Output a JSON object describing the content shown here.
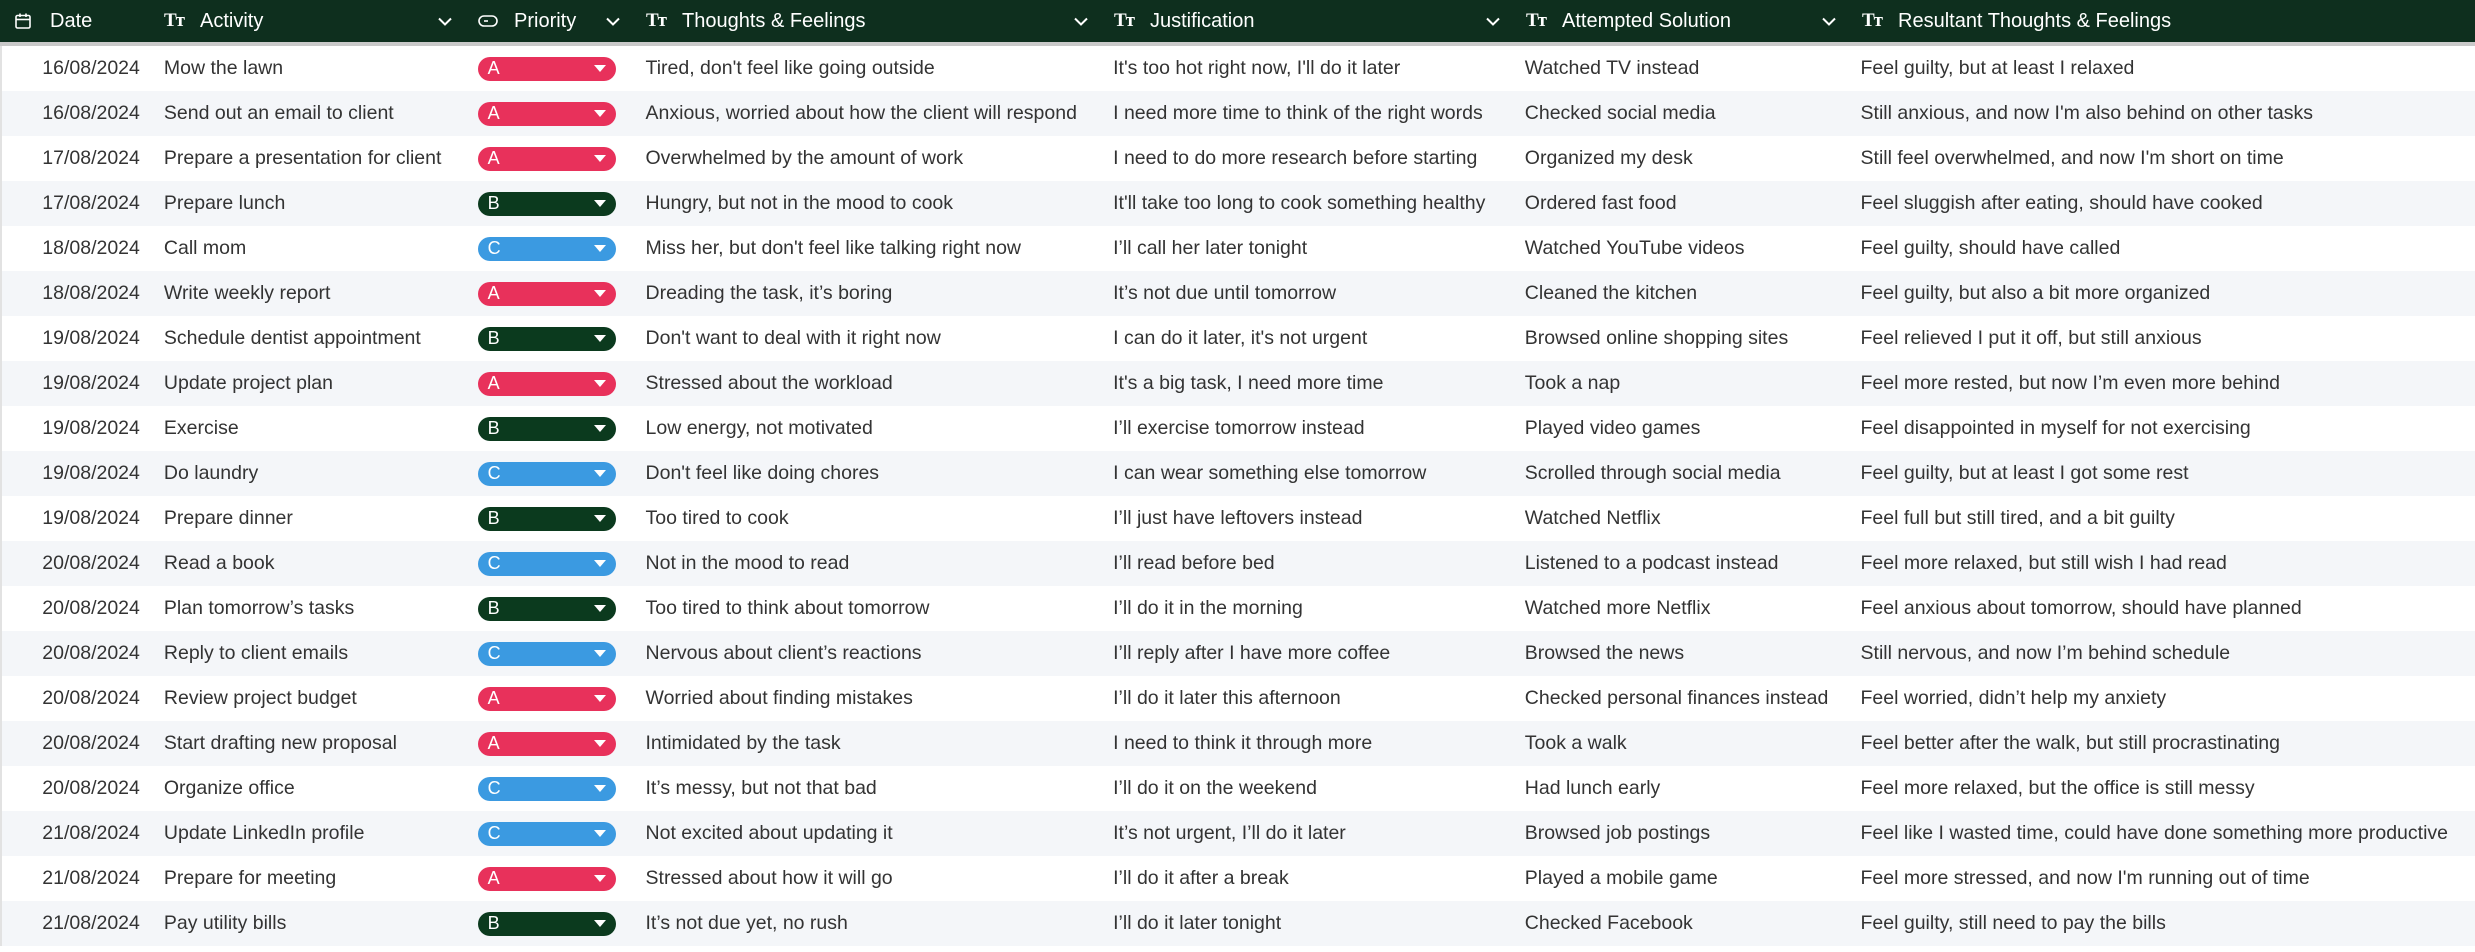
{
  "columns": [
    {
      "key": "date",
      "label": "Date",
      "icon": "calendar-icon"
    },
    {
      "key": "activity",
      "label": "Activity",
      "icon": "text-type-icon"
    },
    {
      "key": "priority",
      "label": "Priority",
      "icon": "select-pill-icon"
    },
    {
      "key": "thoughts",
      "label": "Thoughts & Feelings",
      "icon": "text-type-icon"
    },
    {
      "key": "justification",
      "label": "Justification",
      "icon": "text-type-icon"
    },
    {
      "key": "attempted",
      "label": "Attempted Solution",
      "icon": "text-type-icon"
    },
    {
      "key": "resultant",
      "label": "Resultant Thoughts & Feelings",
      "icon": "text-type-icon"
    }
  ],
  "colors": {
    "header_bg": "#0e2f1e",
    "priority": {
      "A": "#e8315b",
      "B": "#0b3a1e",
      "C": "#3b9ae1"
    }
  },
  "rows": [
    {
      "date": "16/08/2024",
      "activity": "Mow the lawn",
      "priority": "A",
      "thoughts": "Tired, don't feel like going outside",
      "justification": "It's too hot right now, I'll do it later",
      "attempted": "Watched TV instead",
      "resultant": "Feel guilty, but at least I relaxed"
    },
    {
      "date": "16/08/2024",
      "activity": "Send out an email to client",
      "priority": "A",
      "thoughts": "Anxious, worried about how the client will respond",
      "justification": "I need more time to think of the right words",
      "attempted": "Checked social media",
      "resultant": "Still anxious, and now I'm also behind on other tasks"
    },
    {
      "date": "17/08/2024",
      "activity": "Prepare a presentation for client",
      "priority": "A",
      "thoughts": "Overwhelmed by the amount of work",
      "justification": "I need to do more research before starting",
      "attempted": "Organized my desk",
      "resultant": "Still feel overwhelmed, and now I'm short on time"
    },
    {
      "date": "17/08/2024",
      "activity": "Prepare lunch",
      "priority": "B",
      "thoughts": "Hungry, but not in the mood to cook",
      "justification": "It'll take too long to cook something healthy",
      "attempted": "Ordered fast food",
      "resultant": "Feel sluggish after eating, should have cooked"
    },
    {
      "date": "18/08/2024",
      "activity": "Call mom",
      "priority": "C",
      "thoughts": "Miss her, but don't feel like talking right now",
      "justification": "I’ll call her later tonight",
      "attempted": "Watched YouTube videos",
      "resultant": "Feel guilty, should have called"
    },
    {
      "date": "18/08/2024",
      "activity": "Write weekly report",
      "priority": "A",
      "thoughts": "Dreading the task, it’s boring",
      "justification": "It’s not due until tomorrow",
      "attempted": "Cleaned the kitchen",
      "resultant": "Feel guilty, but also a bit more organized"
    },
    {
      "date": "19/08/2024",
      "activity": "Schedule dentist appointment",
      "priority": "B",
      "thoughts": "Don't want to deal with it right now",
      "justification": "I can do it later, it's not urgent",
      "attempted": "Browsed online shopping sites",
      "resultant": "Feel relieved I put it off, but still anxious"
    },
    {
      "date": "19/08/2024",
      "activity": "Update project plan",
      "priority": "A",
      "thoughts": "Stressed about the workload",
      "justification": "It's a big task, I need more time",
      "attempted": "Took a nap",
      "resultant": "Feel more rested, but now I’m even more behind"
    },
    {
      "date": "19/08/2024",
      "activity": "Exercise",
      "priority": "B",
      "thoughts": "Low energy, not motivated",
      "justification": "I’ll exercise tomorrow instead",
      "attempted": "Played video games",
      "resultant": "Feel disappointed in myself for not exercising"
    },
    {
      "date": "19/08/2024",
      "activity": "Do laundry",
      "priority": "C",
      "thoughts": "Don't feel like doing chores",
      "justification": "I can wear something else tomorrow",
      "attempted": "Scrolled through social media",
      "resultant": "Feel guilty, but at least I got some rest"
    },
    {
      "date": "19/08/2024",
      "activity": "Prepare dinner",
      "priority": "B",
      "thoughts": "Too tired to cook",
      "justification": "I’ll just have leftovers instead",
      "attempted": "Watched Netflix",
      "resultant": "Feel full but still tired, and a bit guilty"
    },
    {
      "date": "20/08/2024",
      "activity": "Read a book",
      "priority": "C",
      "thoughts": "Not in the mood to read",
      "justification": "I’ll read before bed",
      "attempted": "Listened to a podcast instead",
      "resultant": "Feel more relaxed, but still wish I had read"
    },
    {
      "date": "20/08/2024",
      "activity": "Plan tomorrow’s tasks",
      "priority": "B",
      "thoughts": "Too tired to think about tomorrow",
      "justification": "I’ll do it in the morning",
      "attempted": "Watched more Netflix",
      "resultant": "Feel anxious about tomorrow, should have planned"
    },
    {
      "date": "20/08/2024",
      "activity": "Reply to client emails",
      "priority": "C",
      "thoughts": "Nervous about client’s reactions",
      "justification": "I’ll reply after I have more coffee",
      "attempted": "Browsed the news",
      "resultant": "Still nervous, and now I’m behind schedule"
    },
    {
      "date": "20/08/2024",
      "activity": "Review project budget",
      "priority": "A",
      "thoughts": "Worried about finding mistakes",
      "justification": "I’ll do it later this afternoon",
      "attempted": "Checked personal finances instead",
      "resultant": "Feel worried, didn’t help my anxiety"
    },
    {
      "date": "20/08/2024",
      "activity": "Start drafting new proposal",
      "priority": "A",
      "thoughts": "Intimidated by the task",
      "justification": "I need to think it through more",
      "attempted": "Took a walk",
      "resultant": "Feel better after the walk, but still procrastinating"
    },
    {
      "date": "20/08/2024",
      "activity": "Organize office",
      "priority": "C",
      "thoughts": "It’s messy, but not that bad",
      "justification": "I’ll do it on the weekend",
      "attempted": "Had lunch early",
      "resultant": "Feel more relaxed, but the office is still messy"
    },
    {
      "date": "21/08/2024",
      "activity": "Update LinkedIn profile",
      "priority": "C",
      "thoughts": "Not excited about updating it",
      "justification": "It’s not urgent, I’ll do it later",
      "attempted": "Browsed job postings",
      "resultant": "Feel like I wasted time, could have done something more productive"
    },
    {
      "date": "21/08/2024",
      "activity": "Prepare for meeting",
      "priority": "A",
      "thoughts": "Stressed about how it will go",
      "justification": "I’ll do it after a break",
      "attempted": "Played a mobile game",
      "resultant": "Feel more stressed, and now I'm running out of time"
    },
    {
      "date": "21/08/2024",
      "activity": "Pay utility bills",
      "priority": "B",
      "thoughts": "It’s not due yet, no rush",
      "justification": "I’ll do it later tonight",
      "attempted": "Checked Facebook",
      "resultant": "Feel guilty, still need to pay the bills"
    }
  ]
}
